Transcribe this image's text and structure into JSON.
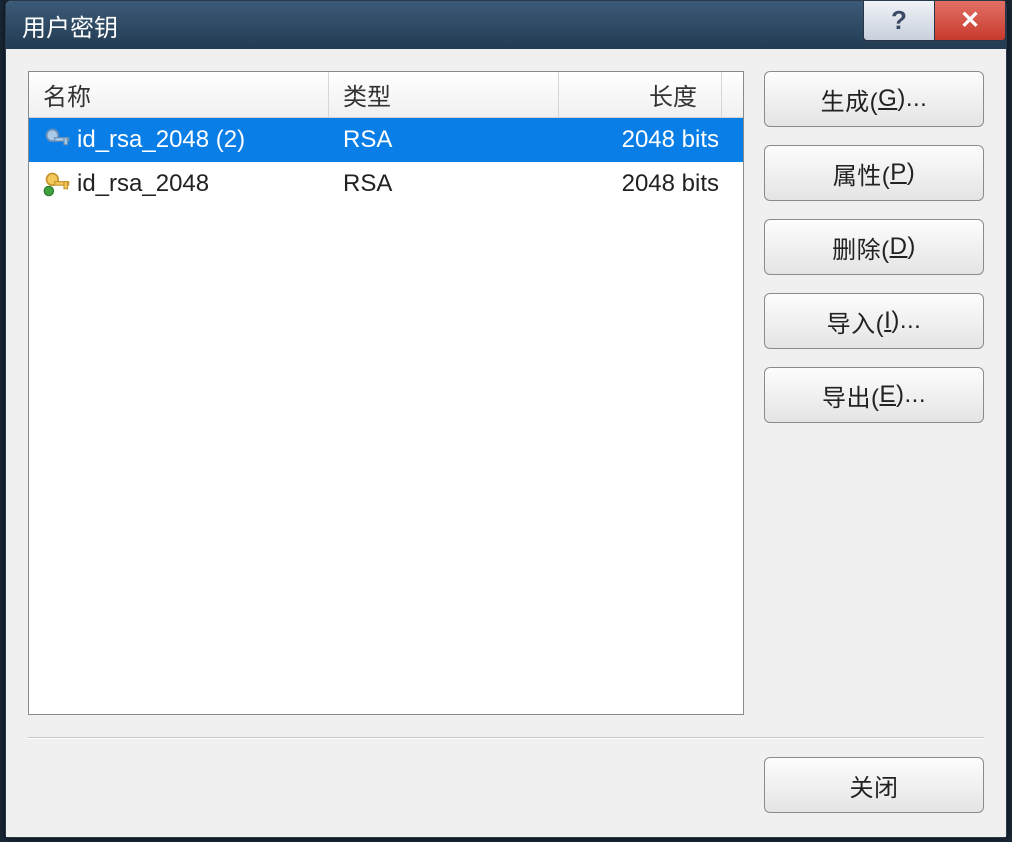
{
  "title": "用户密钥",
  "titlebar": {
    "help_glyph": "?",
    "close_glyph": "✕"
  },
  "columns": {
    "name": "名称",
    "type": "类型",
    "length": "长度"
  },
  "rows": [
    {
      "name": "id_rsa_2048 (2)",
      "type": "RSA",
      "length": "2048 bits",
      "selected": true
    },
    {
      "name": "id_rsa_2048",
      "type": "RSA",
      "length": "2048 bits",
      "selected": false
    }
  ],
  "buttons": {
    "generate": {
      "pre": "生成(",
      "u": "G",
      "post": ")..."
    },
    "props": {
      "pre": "属性(",
      "u": "P",
      "post": ")"
    },
    "delete": {
      "pre": "删除(",
      "u": "D",
      "post": ")"
    },
    "import": {
      "pre": "导入(",
      "u": "I",
      "post": ")..."
    },
    "export": {
      "pre": "导出(",
      "u": "E",
      "post": ")..."
    },
    "close": {
      "label": "关闭"
    }
  }
}
